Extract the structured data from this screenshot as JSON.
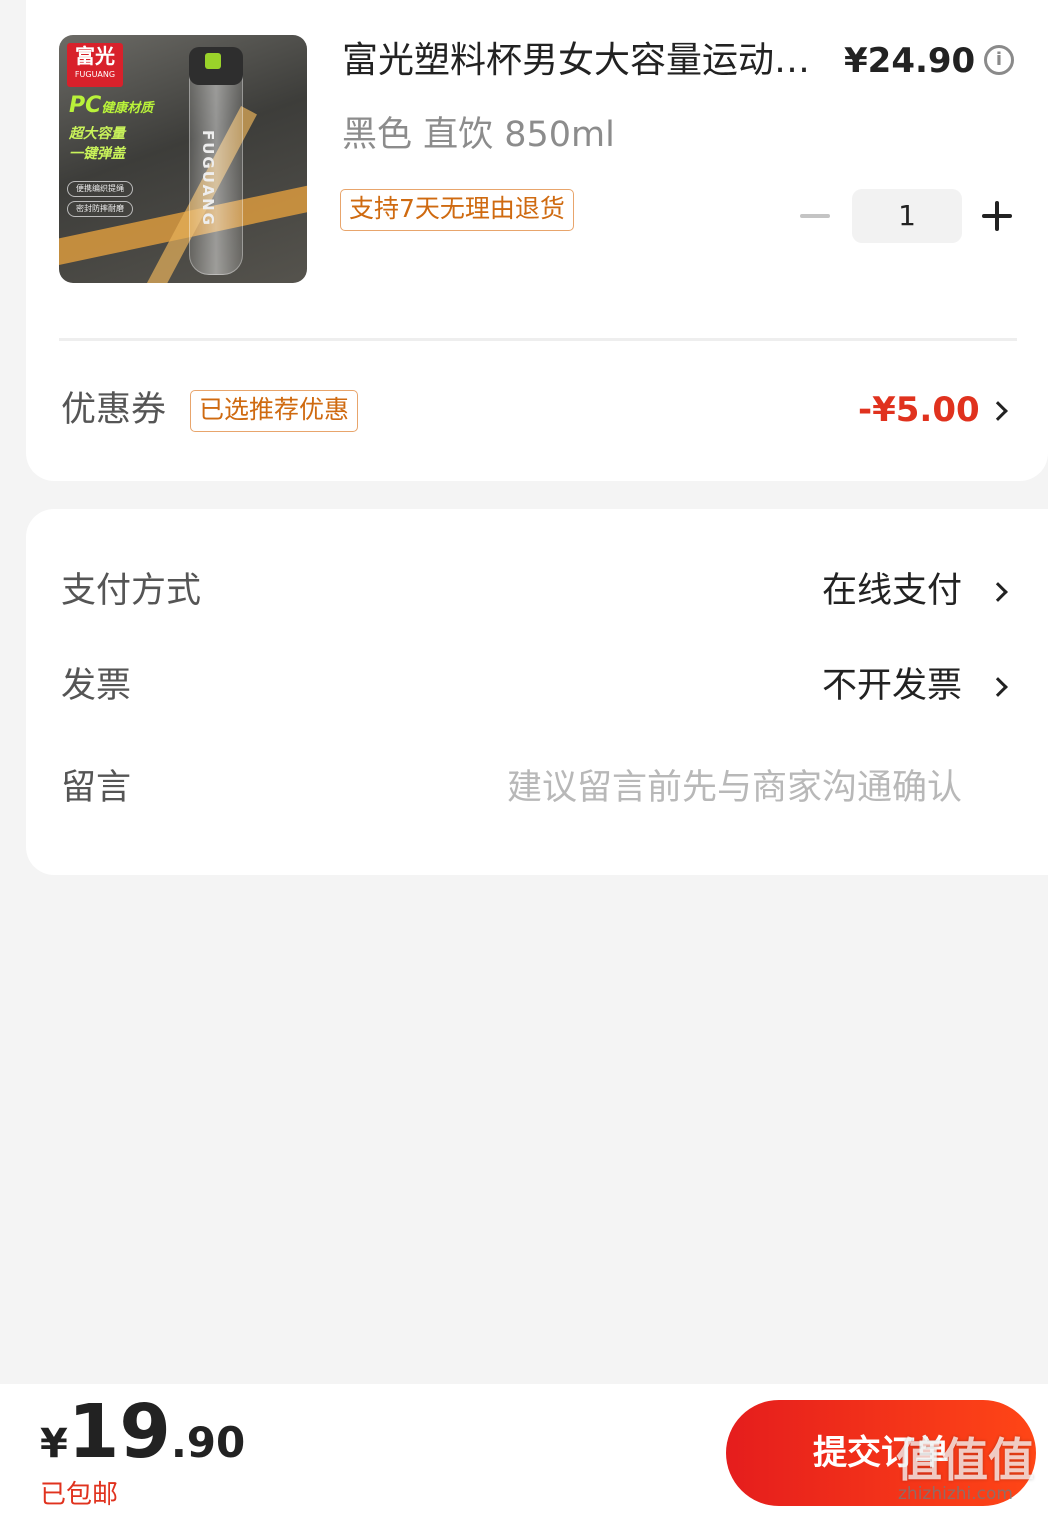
{
  "product": {
    "thumbnail": {
      "logo_cn": "富光",
      "logo_en": "FUGUANG",
      "pc_text": "PC",
      "pc_suffix": "健康材质",
      "line1": "超大容量",
      "line2": "一键弹盖",
      "pill1": "便携编织提绳",
      "pill2": "密封防摔耐磨",
      "bottle_brand": "FUGUANG"
    },
    "title": "富光塑料杯男女大容量运动水杯",
    "price": "¥24.90",
    "info_icon": "info-icon",
    "variant": "黑色 直饮 850ml",
    "return_tag": "支持7天无理由退货",
    "quantity": "1"
  },
  "coupon": {
    "label": "优惠券",
    "tag": "已选推荐优惠",
    "value": "-¥5.00"
  },
  "options": {
    "payment": {
      "label": "支付方式",
      "value": "在线支付"
    },
    "invoice": {
      "label": "发票",
      "value": "不开发票"
    },
    "message": {
      "label": "留言",
      "placeholder": "建议留言前先与商家沟通确认"
    }
  },
  "footer": {
    "currency": "¥",
    "total_int": "19",
    "total_dec": ".90",
    "shipping": "已包邮",
    "submit_label": "提交订单",
    "watermark": "值值值",
    "watermark_url": "zhizhizhi.com"
  },
  "colors": {
    "accent_red": "#e0321e",
    "tag_orange": "#cf6a10",
    "button_red": "#e51d1d"
  }
}
